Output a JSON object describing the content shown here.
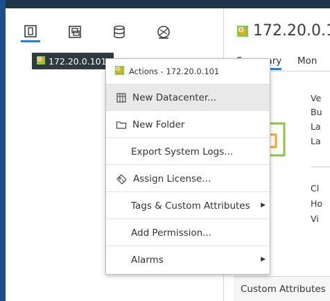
{
  "sidebar": {
    "tree_node_label": "172.20.0.101",
    "nav_tabs": [
      "hosts-clusters",
      "vms-templates",
      "storage",
      "networking"
    ]
  },
  "main": {
    "title": "172.20.0.1",
    "tabs": [
      "Summary",
      "Mon"
    ],
    "summary_labels_top": [
      "Ve",
      "Bu",
      "La",
      "La"
    ],
    "summary_labels_bottom": [
      "Cl",
      "Ho",
      "Vi"
    ],
    "custom_attributes_label": "Custom Attributes"
  },
  "context_menu": {
    "header": "Actions - 172.20.0.101",
    "items": [
      {
        "label": "New Datacenter...",
        "icon": "datacenter-icon",
        "submenu": false,
        "highlighted": true
      },
      {
        "label": "New Folder",
        "icon": "folder-icon",
        "submenu": false,
        "highlighted": false
      },
      {
        "label": "Export System Logs...",
        "icon": "",
        "submenu": false,
        "highlighted": false
      },
      {
        "label": "Assign License...",
        "icon": "license-icon",
        "submenu": false,
        "highlighted": false
      },
      {
        "label": "Tags & Custom Attributes",
        "icon": "",
        "submenu": true,
        "highlighted": false
      },
      {
        "label": "Add Permission...",
        "icon": "",
        "submenu": false,
        "highlighted": false
      },
      {
        "label": "Alarms",
        "icon": "",
        "submenu": true,
        "highlighted": false
      }
    ]
  },
  "colors": {
    "accent": "#2d7dd2",
    "vcenter_icon": "#8cc63f",
    "vcenter_icon_inner": "#f5a623",
    "topbar": "#1d3548",
    "selected_node_bg": "#2d3a40"
  }
}
